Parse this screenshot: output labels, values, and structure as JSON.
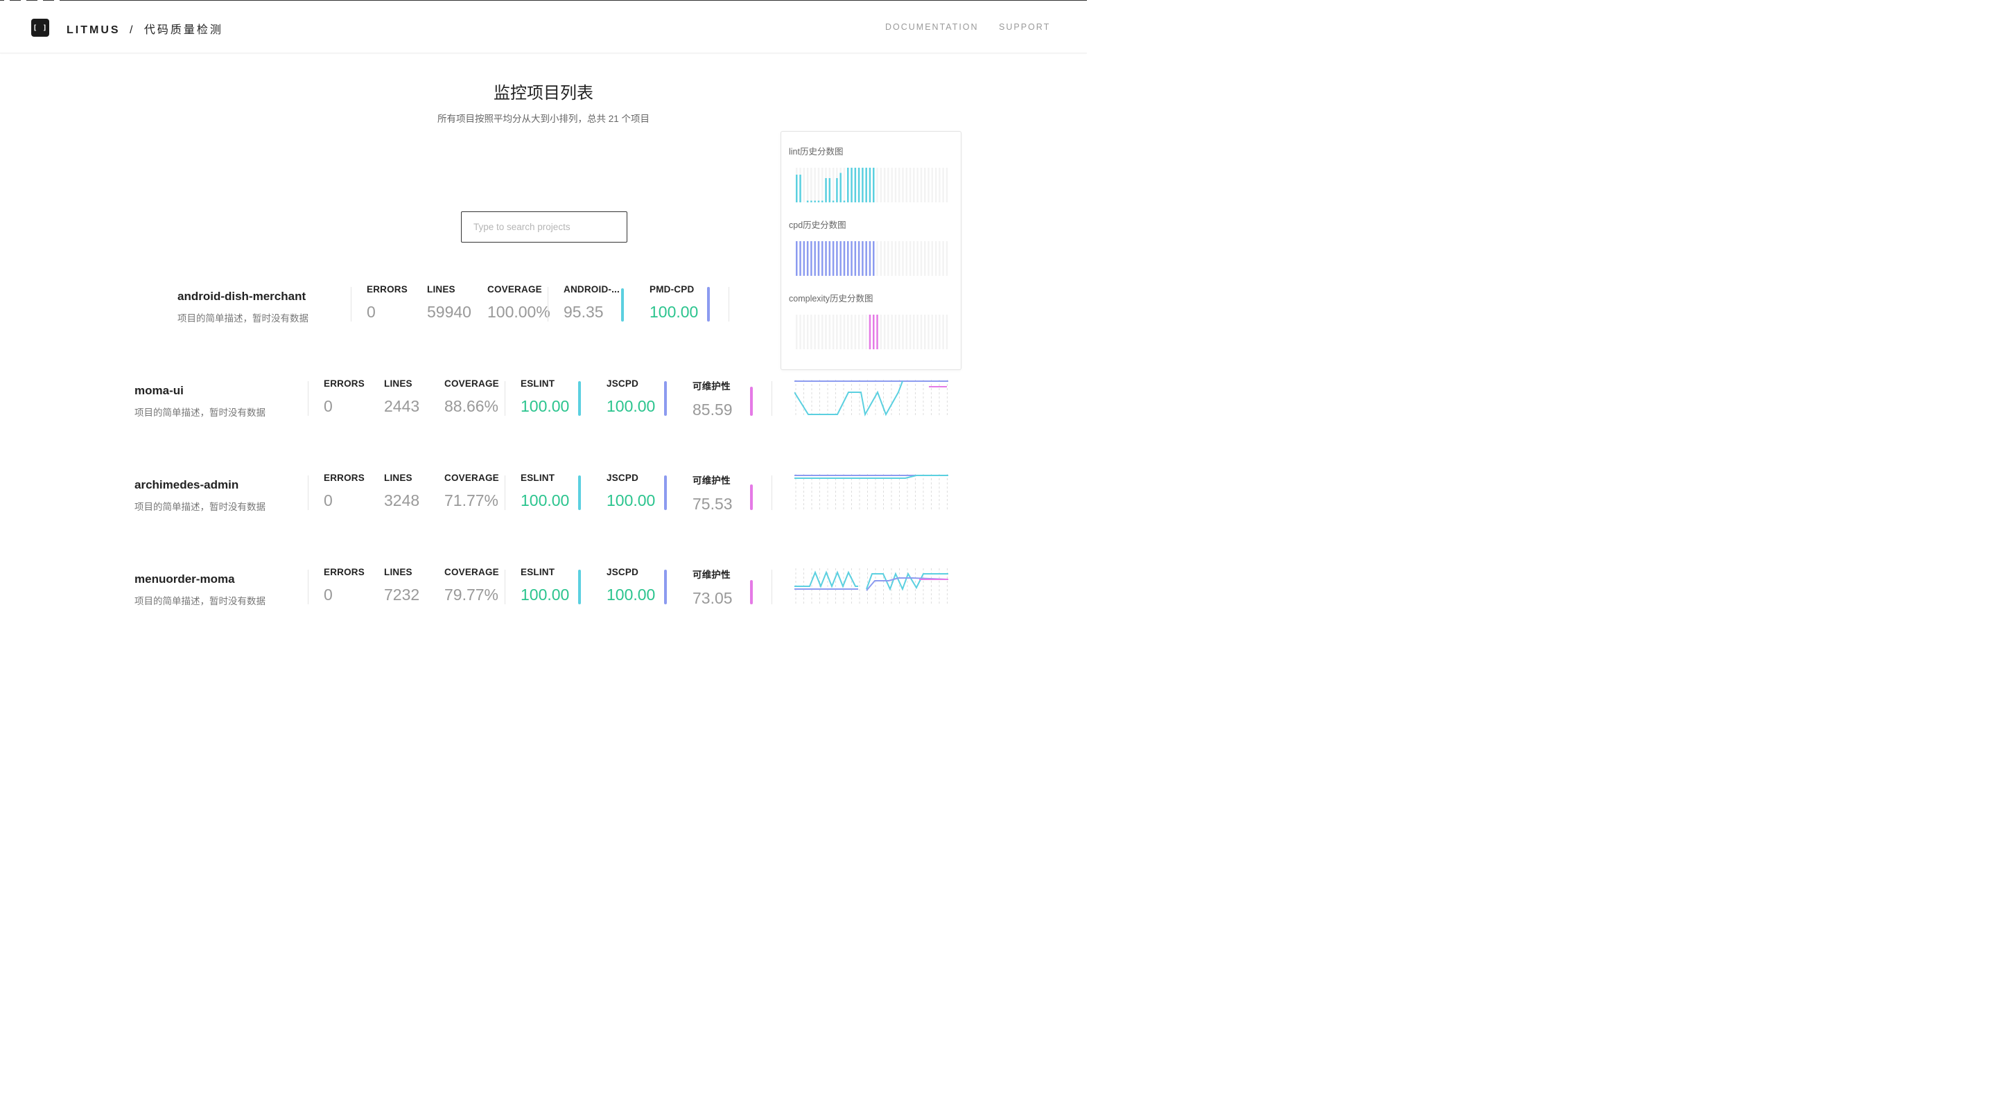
{
  "header": {
    "logo_text": "[ ]",
    "brand_name": "LITMUS",
    "brand_sep": "/",
    "brand_sub": "代码质量检测",
    "nav": [
      {
        "label": "DOCUMENTATION"
      },
      {
        "label": "SUPPORT"
      }
    ]
  },
  "page": {
    "title": "监控项目列表",
    "subtitle": "所有项目按照平均分从大到小排列，总共 21 个项目"
  },
  "search": {
    "placeholder": "Type to search projects",
    "value": ""
  },
  "projects": [
    {
      "name": "android-dish-merchant",
      "desc": "项目的简单描述，暂时没有数据",
      "metrics": [
        {
          "label": "ERRORS",
          "value": "0"
        },
        {
          "label": "LINES",
          "value": "59940"
        },
        {
          "label": "COVERAGE",
          "value": "100.00%"
        },
        {
          "label": "ANDROID-...",
          "value": "95.35",
          "bar_color": "#5bd0e0"
        },
        {
          "label": "PMD-CPD",
          "value": "100.00",
          "bar_color": "#8c9bf0"
        }
      ]
    },
    {
      "name": "moma-ui",
      "desc": "项目的简单描述，暂时没有数据",
      "metrics": [
        {
          "label": "ERRORS",
          "value": "0"
        },
        {
          "label": "LINES",
          "value": "2443"
        },
        {
          "label": "COVERAGE",
          "value": "88.66%"
        },
        {
          "label": "ESLINT",
          "value": "100.00",
          "bar_color": "#5bd0e0"
        },
        {
          "label": "JSCPD",
          "value": "100.00",
          "bar_color": "#8c9bf0"
        },
        {
          "label": "可维护性",
          "value": "85.59",
          "bar_color": "#e57ae6"
        }
      ]
    },
    {
      "name": "archimedes-admin",
      "desc": "项目的简单描述，暂时没有数据",
      "metrics": [
        {
          "label": "ERRORS",
          "value": "0"
        },
        {
          "label": "LINES",
          "value": "3248"
        },
        {
          "label": "COVERAGE",
          "value": "71.77%"
        },
        {
          "label": "ESLINT",
          "value": "100.00",
          "bar_color": "#5bd0e0"
        },
        {
          "label": "JSCPD",
          "value": "100.00",
          "bar_color": "#8c9bf0"
        },
        {
          "label": "可维护性",
          "value": "75.53",
          "bar_color": "#e57ae6"
        }
      ]
    },
    {
      "name": "menuorder-moma",
      "desc": "项目的简单描述，暂时没有数据",
      "metrics": [
        {
          "label": "ERRORS",
          "value": "0"
        },
        {
          "label": "LINES",
          "value": "7232"
        },
        {
          "label": "COVERAGE",
          "value": "79.77%"
        },
        {
          "label": "ESLINT",
          "value": "100.00",
          "bar_color": "#5bd0e0"
        },
        {
          "label": "JSCPD",
          "value": "100.00",
          "bar_color": "#8c9bf0"
        },
        {
          "label": "可维护性",
          "value": "73.05",
          "bar_color": "#e57ae6"
        }
      ]
    }
  ],
  "history_popover": {
    "charts": [
      {
        "title": "lint历史分数图",
        "color": "#5bd0e0",
        "values": [
          0.8,
          0.8,
          0,
          0.05,
          0.05,
          0.05,
          0.05,
          0.05,
          0.7,
          0.7,
          0.05,
          0.7,
          0.85,
          0.05,
          1,
          1,
          1,
          1,
          1,
          1,
          1,
          1,
          0,
          0,
          0,
          0,
          0,
          0,
          0,
          0,
          0,
          0,
          0,
          0,
          0,
          0,
          0,
          0,
          0,
          0,
          0,
          0
        ]
      },
      {
        "title": "cpd历史分数图",
        "color": "#8c9bf0",
        "values": [
          1,
          1,
          1,
          1,
          1,
          1,
          1,
          1,
          1,
          1,
          1,
          1,
          1,
          1,
          1,
          1,
          1,
          1,
          1,
          1,
          1,
          1,
          0,
          0,
          0,
          0,
          0,
          0,
          0,
          0,
          0,
          0,
          0,
          0,
          0,
          0,
          0,
          0,
          0,
          0,
          0,
          0
        ]
      },
      {
        "title": "complexity历史分数图",
        "color": "#e57ae6",
        "values": [
          0,
          0,
          0,
          0,
          0,
          0,
          0,
          0,
          0,
          0,
          0,
          0,
          0,
          0,
          0,
          0,
          0,
          0,
          0,
          0,
          1,
          1,
          1,
          0,
          0,
          0,
          0,
          0,
          0,
          0,
          0,
          0,
          0,
          0,
          0,
          0,
          0,
          0,
          0,
          0,
          0,
          0
        ]
      }
    ]
  }
}
